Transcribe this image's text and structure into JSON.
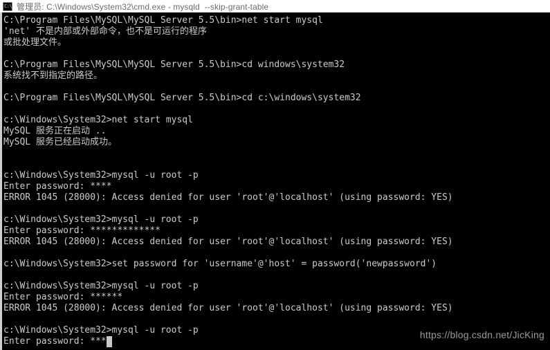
{
  "window": {
    "title": "管理员: C:\\Windows\\System32\\cmd.exe - mysqld  --skip-grant-table",
    "icon": "cmd-console-icon",
    "titlebar_bg": "#ffffff",
    "titlebar_fg": "#6b6b6b",
    "console_bg": "#000000",
    "console_fg": "#c8c8c8"
  },
  "console": {
    "lines": [
      "C:\\Program Files\\MySQL\\MySQL Server 5.5\\bin>net start mysql",
      "'net' 不是内部或外部命令，也不是可运行的程序",
      "或批处理文件。",
      "",
      "C:\\Program Files\\MySQL\\MySQL Server 5.5\\bin>cd windows\\system32",
      "系统找不到指定的路径。",
      "",
      "C:\\Program Files\\MySQL\\MySQL Server 5.5\\bin>cd c:\\windows\\system32",
      "",
      "c:\\Windows\\System32>net start mysql",
      "MySQL 服务正在启动 ..",
      "MySQL 服务已经启动成功。",
      "",
      "",
      "c:\\Windows\\System32>mysql -u root -p",
      "Enter password: ****",
      "ERROR 1045 (28000): Access denied for user 'root'@'localhost' (using password: YES)",
      "",
      "c:\\Windows\\System32>mysql -u root -p",
      "Enter password: *************",
      "ERROR 1045 (28000): Access denied for user 'root'@'localhost' (using password: YES)",
      "",
      "c:\\Windows\\System32>set password for 'username'@'host' = password('newpassword')",
      "",
      "c:\\Windows\\System32>mysql -u root -p",
      "Enter password: ******",
      "ERROR 1045 (28000): Access denied for user 'root'@'localhost' (using password: YES)",
      "",
      "c:\\Windows\\System32>mysql -u root -p",
      "Enter password: ***"
    ]
  },
  "watermark": {
    "text": "https://blog.csdn.net/JicKing"
  }
}
